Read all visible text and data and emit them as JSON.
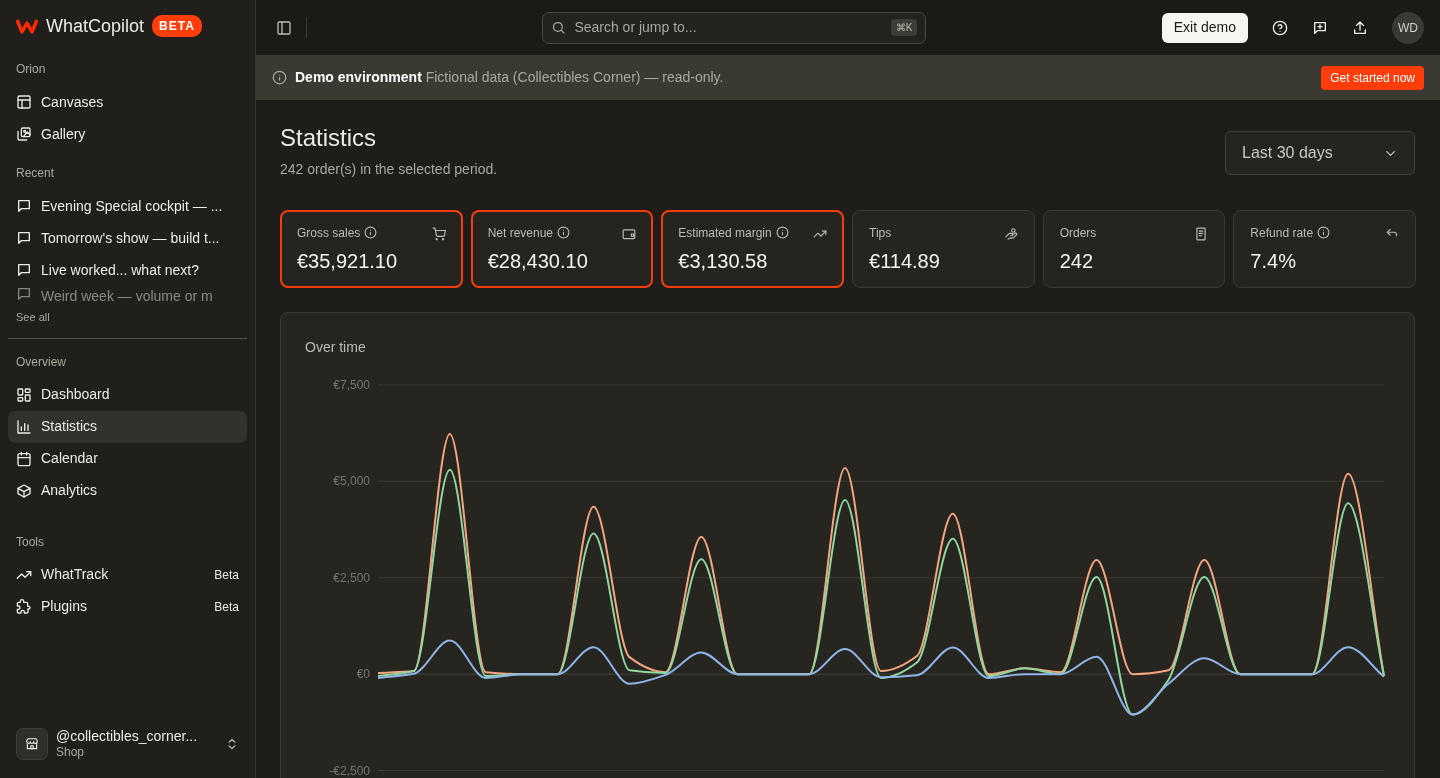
{
  "brand": {
    "name": "WhatCopilot",
    "badge": "BETA"
  },
  "sidebar": {
    "sections": [
      {
        "title": "Orion",
        "items": [
          {
            "label": "Canvases",
            "kind": "layout",
            "selected": false
          },
          {
            "label": "Gallery",
            "kind": "images",
            "selected": false
          }
        ]
      },
      {
        "title": "Recent",
        "items": [
          {
            "label": "Evening Special cockpit — ...",
            "kind": "chat",
            "selected": false,
            "faded": false
          },
          {
            "label": "Tomorrow's show — build t...",
            "kind": "chat",
            "selected": false,
            "faded": false
          },
          {
            "label": "Live worked... what next?",
            "kind": "chat",
            "selected": false,
            "faded": false
          },
          {
            "label": "Weird week — volume or m",
            "kind": "chat",
            "selected": false,
            "faded": true
          }
        ],
        "see_all": "See all"
      },
      {
        "title": "Overview",
        "items": [
          {
            "label": "Dashboard",
            "kind": "grid",
            "selected": false
          },
          {
            "label": "Statistics",
            "kind": "bars",
            "selected": true
          },
          {
            "label": "Calendar",
            "kind": "calendar",
            "selected": false
          },
          {
            "label": "Analytics",
            "kind": "box",
            "selected": false
          }
        ]
      },
      {
        "title": "Tools",
        "items": [
          {
            "label": "WhatTrack",
            "kind": "trend",
            "selected": false,
            "tag": "Beta"
          },
          {
            "label": "Plugins",
            "kind": "puzzle",
            "selected": false,
            "tag": "Beta"
          }
        ]
      }
    ],
    "account": {
      "name": "@collectibles_corner...",
      "role": "Shop"
    }
  },
  "topbar": {
    "search": {
      "placeholder": "Search or jump to...",
      "shortcut": "⌘K"
    },
    "exit_button": "Exit demo",
    "avatar": "WD"
  },
  "banner": {
    "text": "**Demo environment** Fictional data (Collectibles Corner) — read-only.",
    "button": "Get started now"
  },
  "page": {
    "title": "Statistics",
    "subtitle": "242 order(s) in the selected period.",
    "period": "Last 30 days"
  },
  "kpis": [
    {
      "label": "Gross sales",
      "value": "€35,921.10",
      "info": true,
      "kind": "cart",
      "highlighted": true
    },
    {
      "label": "Net revenue",
      "value": "€28,430.10",
      "info": true,
      "kind": "wallet",
      "highlighted": true
    },
    {
      "label": "Estimated margin",
      "value": "€3,130.58",
      "info": true,
      "kind": "trend",
      "highlighted": true
    },
    {
      "label": "Tips",
      "value": "€114.89",
      "info": false,
      "kind": "tips",
      "highlighted": false
    },
    {
      "label": "Orders",
      "value": "242",
      "info": false,
      "kind": "receipt",
      "highlighted": false
    },
    {
      "label": "Refund rate",
      "value": "7.4%",
      "info": true,
      "kind": "undo",
      "highlighted": false
    }
  ],
  "chart": {
    "title": "Over time",
    "chart_data": {
      "type": "line",
      "ylim": [
        -2500,
        7500
      ],
      "yticks": [
        {
          "value": -2500,
          "label": "-€2,500"
        },
        {
          "value": 0,
          "label": "€0"
        },
        {
          "value": 2500,
          "label": "€2,500"
        },
        {
          "value": 5000,
          "label": "€5,000"
        },
        {
          "value": 7500,
          "label": "€7,500"
        }
      ],
      "series": [
        {
          "color": "#f4a582",
          "values": [
            30,
            80,
            6230,
            50,
            0,
            0,
            4340,
            440,
            50,
            3560,
            0,
            0,
            0,
            5350,
            80,
            470,
            4160,
            0,
            150,
            50,
            2960,
            0,
            100,
            2960,
            0,
            0,
            0,
            5200,
            -50
          ]
        },
        {
          "color": "#8fd6a0",
          "values": [
            -50,
            80,
            5300,
            -50,
            0,
            0,
            3650,
            100,
            30,
            2980,
            0,
            0,
            0,
            4520,
            -100,
            300,
            3510,
            -50,
            150,
            0,
            2520,
            -1050,
            -150,
            2520,
            0,
            0,
            0,
            4430,
            -50
          ]
        },
        {
          "color": "#8fb4e8",
          "values": [
            -100,
            10,
            870,
            -100,
            0,
            0,
            700,
            -250,
            -20,
            560,
            0,
            0,
            0,
            650,
            -80,
            -30,
            690,
            -100,
            0,
            0,
            450,
            -1050,
            -250,
            410,
            0,
            0,
            0,
            700,
            -70
          ]
        }
      ]
    }
  }
}
